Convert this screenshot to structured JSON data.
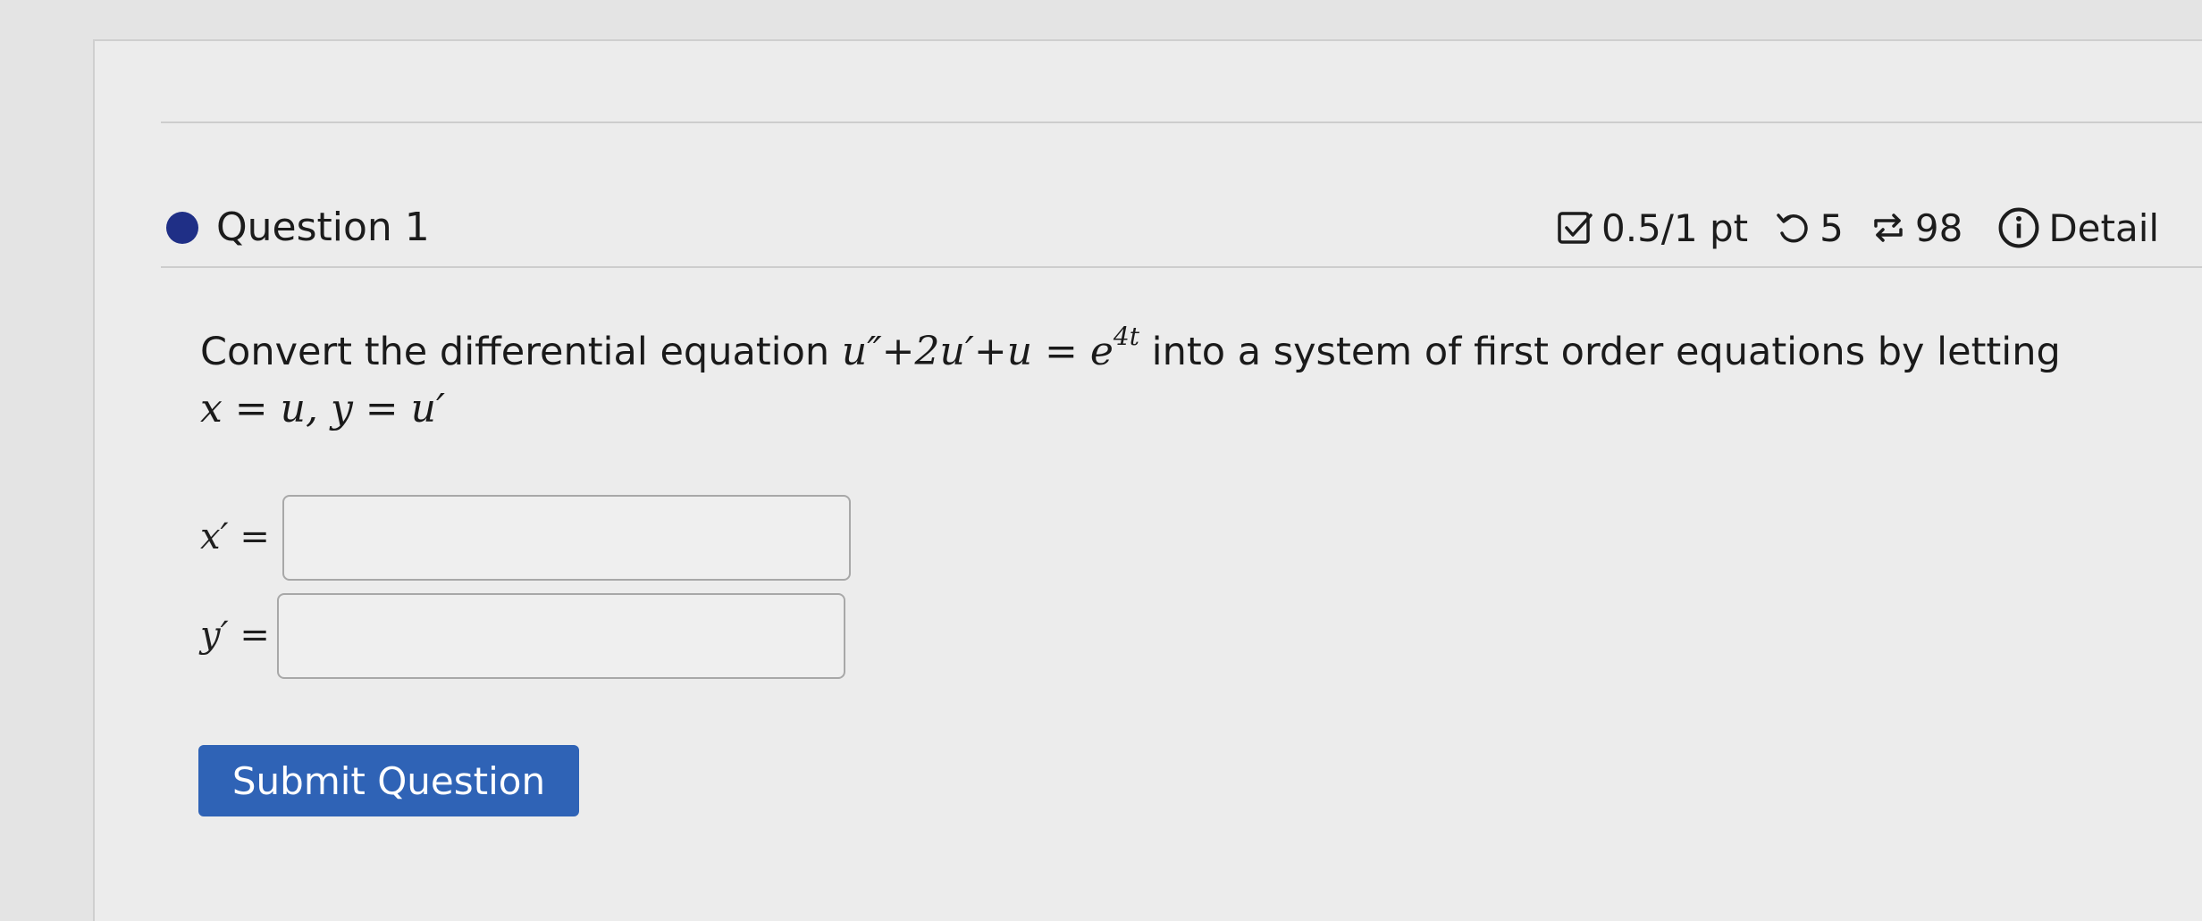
{
  "question": {
    "title": "Question 1",
    "score": "0.5/1 pt",
    "retries": "5",
    "attempts": "98",
    "details_label": "Detail",
    "accent_color": "#1f2f86"
  },
  "prompt": {
    "text_before": "Convert the differential equation ",
    "equation_base": "u″+2u′+u = e",
    "equation_exponent": "4t",
    "text_after": " into a system of first order equations by letting",
    "substitution": "x = u,  y = u′"
  },
  "answers": {
    "x_label": "x′ =",
    "x_value": "",
    "y_label": "y′ =",
    "y_value": ""
  },
  "submit": {
    "label": "Submit Question",
    "color": "#2f63b6"
  },
  "icons": {
    "score": "check-square-icon",
    "retries": "undo-icon",
    "attempts": "repeat-icon",
    "details": "info-icon"
  }
}
